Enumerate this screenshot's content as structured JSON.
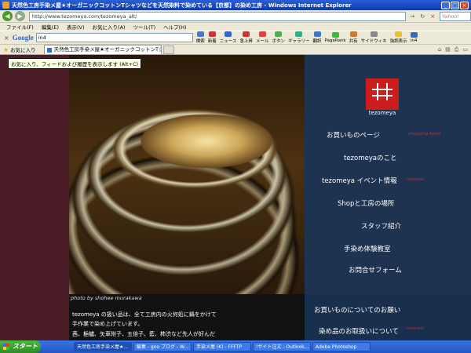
{
  "window": {
    "title": "天然色工房手染メ屋★オーガニックコットンTシャツなどを天然染料で染めている【京都】の染め工房 - Windows Internet Explorer",
    "min": "_",
    "max": "□",
    "close": "×"
  },
  "address": {
    "url": "http://www.tezomeya.com/tezomeya_alt/",
    "search_placeholder": "Yahoo!"
  },
  "menu": [
    "ファイル(F)",
    "編集(E)",
    "表示(V)",
    "お気に入り(A)",
    "ツール(T)",
    "ヘルプ(H)"
  ],
  "google_toolbar": {
    "logo": "Google",
    "query": "in4",
    "search_label": "検索",
    "tools": [
      "新着",
      "ニュース",
      "急上昇",
      "メール",
      "ボタン",
      "ギャラリー",
      "翻訳",
      "PageRank",
      "共有",
      "サイドウィキ",
      "強調表示",
      "in4"
    ]
  },
  "tabs": {
    "favorites_label": "お気に入り",
    "active_tab": "天然色工房手染メ屋★オーガニックコットンTシャツな..."
  },
  "tooltip": "お気に入り、フィードおよび履歴を表示します (Alt+C)",
  "site": {
    "logo_text": "tezomeya",
    "nav": [
      {
        "label": "お買いものページ",
        "badge": "shopping here!"
      },
      {
        "label": "tezomeyaのこと",
        "badge": ""
      },
      {
        "label": "tezomeya イベント情報",
        "badge": "renewal"
      },
      {
        "label": "Shopと工房の場所",
        "badge": ""
      },
      {
        "label": "スタッフ紹介",
        "badge": ""
      },
      {
        "label": "手染め体験教室",
        "badge": ""
      },
      {
        "label": "お問合せフォーム",
        "badge": ""
      }
    ],
    "lower_nav": [
      {
        "label": "お買いものについてのお願い",
        "badge": ""
      },
      {
        "label": "染め品のお取扱いについて",
        "badge": "renewal"
      }
    ],
    "photo_credit": "photo by shohee murakawa",
    "body_lines": [
      "tezomeya の扱い品は、全て工房内の火何処に鍋をかけて",
      "手作業で染め上げています。",
      "茜、梔櫨、矢車附子、五倍子、藍、柿渋など先人が好んだ"
    ]
  },
  "taskbar": {
    "start": "スタート",
    "items": [
      "天然色工房手染メ屋★...",
      "編集 - goo ブログ - W...",
      "手染メ屋 (K) - FFFTP",
      "!サイト注文 - Outlook...",
      "Adobe Photoshop"
    ]
  }
}
